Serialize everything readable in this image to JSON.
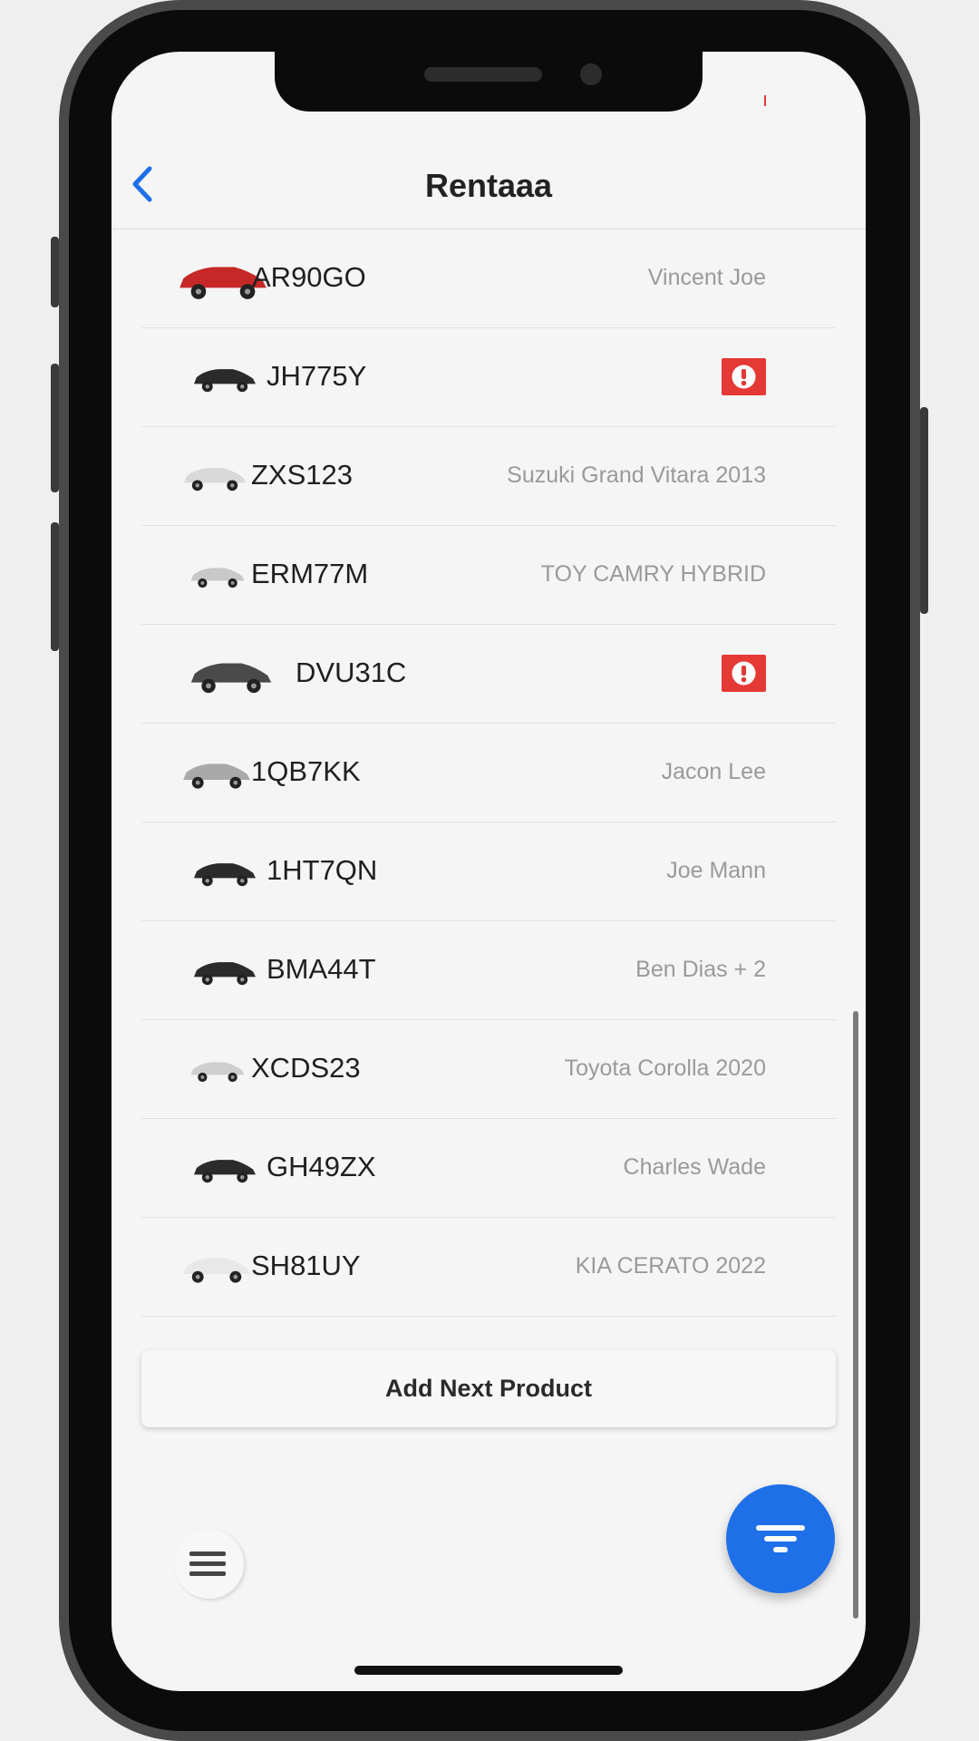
{
  "header": {
    "title": "Rentaaa"
  },
  "vehicles": [
    {
      "plate": "AR90GO",
      "subtitle": "Vincent Joe",
      "alert": false,
      "car_color": "#c62828"
    },
    {
      "plate": "JH775Y",
      "subtitle": "",
      "alert": true,
      "car_color": "#2b2b2b"
    },
    {
      "plate": "ZXS123",
      "subtitle": "Suzuki Grand Vitara 2013",
      "alert": false,
      "car_color": "#d9d9d9"
    },
    {
      "plate": "ERM77M",
      "subtitle": "TOY CAMRY HYBRID",
      "alert": false,
      "car_color": "#c8c8c8"
    },
    {
      "plate": "DVU31C",
      "subtitle": "",
      "alert": true,
      "car_color": "#4a4a4a"
    },
    {
      "plate": "1QB7KK",
      "subtitle": "Jacon Lee",
      "alert": false,
      "car_color": "#a9a9a9"
    },
    {
      "plate": "1HT7QN",
      "subtitle": "Joe Mann",
      "alert": false,
      "car_color": "#2b2b2b"
    },
    {
      "plate": "BMA44T",
      "subtitle": "Ben Dias + 2",
      "alert": false,
      "car_color": "#2b2b2b"
    },
    {
      "plate": "XCDS23",
      "subtitle": "Toyota Corolla 2020",
      "alert": false,
      "car_color": "#cfcfcf"
    },
    {
      "plate": "GH49ZX",
      "subtitle": "Charles Wade",
      "alert": false,
      "car_color": "#2b2b2b"
    },
    {
      "plate": "SH81UY",
      "subtitle": "KIA CERATO 2022",
      "alert": false,
      "car_color": "#e8e8e8"
    }
  ],
  "actions": {
    "add_label": "Add Next Product"
  },
  "icons": {
    "back": "chevron-left-icon",
    "alert": "exclamation-circle-icon",
    "menu": "hamburger-menu-icon",
    "filter": "filter-icon"
  },
  "colors": {
    "accent": "#1f6fe8",
    "alert": "#e53935",
    "subtitle": "#9a9a9a"
  }
}
